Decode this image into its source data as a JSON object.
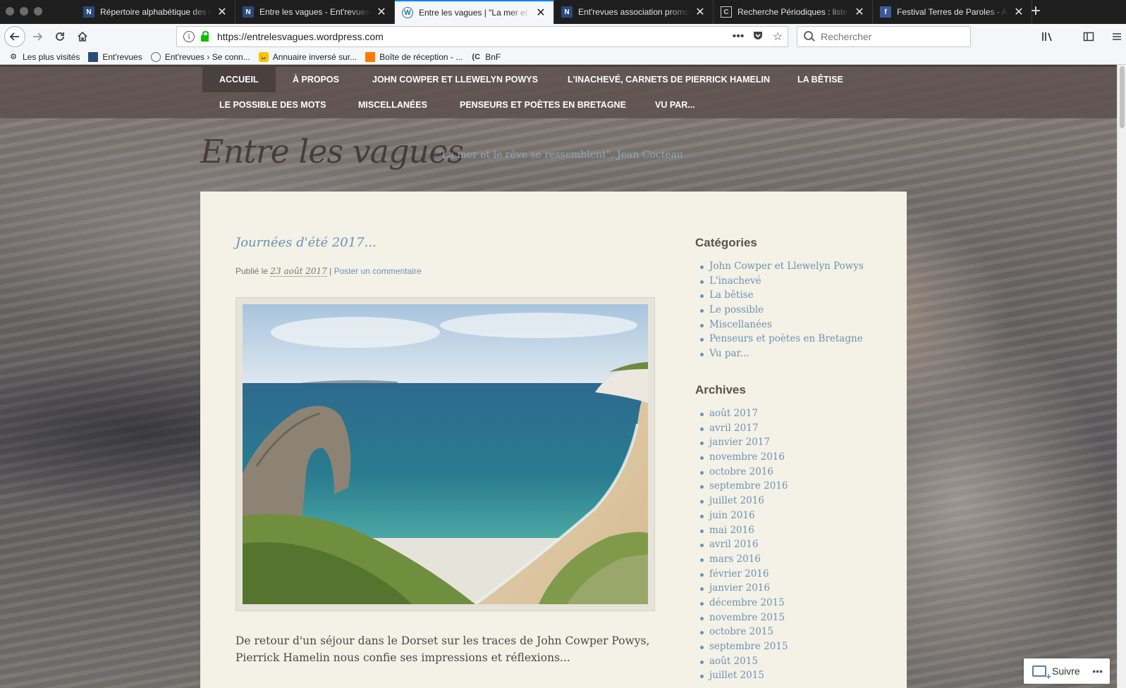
{
  "browser": {
    "tabs": [
      {
        "title": "Répertoire alphabétique des revues",
        "favicon": "N",
        "active": false
      },
      {
        "title": "Entre les vagues - Ent'revues, le site",
        "favicon": "N",
        "active": false
      },
      {
        "title": "Entre les vagues | \"La mer et le rêve",
        "favicon": "W",
        "active": true
      },
      {
        "title": "Ent'revues association promotion",
        "favicon": "N",
        "active": false
      },
      {
        "title": "Recherche Périodiques : liste des",
        "favicon": "C",
        "active": false
      },
      {
        "title": "Festival Terres de Paroles - Accueil",
        "favicon": "f",
        "active": false
      }
    ],
    "close_glyph": "✕",
    "new_tab_glyph": "+",
    "url": "https://entrelesvagues.wordpress.com",
    "search_placeholder": "Rechercher",
    "bookmarks": [
      {
        "label": "Les plus visités",
        "icon": "gear-icon"
      },
      {
        "label": "Ent'revues",
        "icon": "entrevues-icon"
      },
      {
        "label": "Ent'revues › Se conn...",
        "icon": "globe-icon"
      },
      {
        "label": "Annuaire inversé sur...",
        "icon": "smiley-icon"
      },
      {
        "label": "Boîte de réception - ...",
        "icon": "orange-icon"
      },
      {
        "label": "BnF",
        "icon": "bnf-icon"
      }
    ]
  },
  "site": {
    "menu_row1": [
      "Accueil",
      "À propos",
      "John Cowper et Llewelyn Powys",
      "L'inachevé, carnets de Pierrick Hamelin",
      "La bêtise"
    ],
    "menu_row2": [
      "Le possible des mots",
      "Miscellanées",
      "Penseurs et poètes en Bretagne",
      "Vu par..."
    ],
    "title": "Entre les vagues",
    "description": "\"La mer et le rêve se ressemblent\", Jean Cocteau"
  },
  "post": {
    "title": "Journées d'été 2017...",
    "published_prefix": "Publié le",
    "date": "23 août 2017",
    "separator": "|",
    "comment_link": "Poster un commentaire",
    "excerpt": "De retour d'un séjour dans le Dorset sur les traces de John Cowper Powys, Pierrick Hamelin nous confie ses impressions et réflexions..."
  },
  "sidebar": {
    "categories_title": "Catégories",
    "categories": [
      "John Cowper et Llewelyn Powys",
      "L'inachevé",
      "La bêtise",
      "Le possible",
      "Miscellanées",
      "Penseurs et poètes en Bretagne",
      "Vu par..."
    ],
    "archives_title": "Archives",
    "archives": [
      "août 2017",
      "avril 2017",
      "janvier 2017",
      "novembre 2016",
      "octobre 2016",
      "septembre 2016",
      "juillet 2016",
      "juin 2016",
      "mai 2016",
      "avril 2016",
      "mars 2016",
      "février 2016",
      "janvier 2016",
      "décembre 2015",
      "novembre 2015",
      "octobre 2015",
      "septembre 2015",
      "août 2015",
      "juillet 2015"
    ]
  },
  "follow": {
    "label": "Suivre",
    "more": "•••"
  },
  "colors": {
    "accent": "#0a84ff",
    "link": "#6a93b5",
    "nav_bg": "#5c504c",
    "content_bg": "#f4f1e6"
  }
}
